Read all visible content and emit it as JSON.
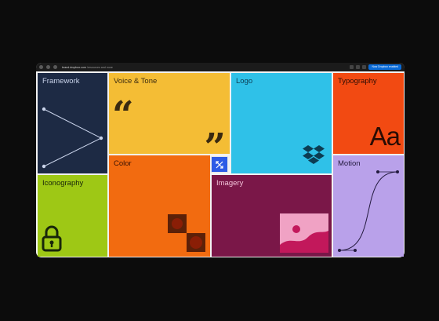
{
  "browser": {
    "url_host": "brand.dropbox.com",
    "url_rest": "/resources and more",
    "action_button": "Now Dropbox enabled"
  },
  "tiles": [
    {
      "id": "framework",
      "label": "Framework",
      "bg": "#1d2a44",
      "fg": "#c9d3ea"
    },
    {
      "id": "voice",
      "label": "Voice & Tone",
      "bg": "#f4bd35",
      "fg": "#3a2a10"
    },
    {
      "id": "logo",
      "label": "Logo",
      "bg": "#2fc1e8",
      "fg": "#0c3c52"
    },
    {
      "id": "typography",
      "label": "Typography",
      "bg": "#f24a12",
      "fg": "#2a0c04"
    },
    {
      "id": "iconography",
      "label": "Iconography",
      "bg": "#9ec815",
      "fg": "#18260a"
    },
    {
      "id": "color",
      "label": "Color",
      "bg": "#f26b10",
      "fg": "#3a1204"
    },
    {
      "id": "imagery",
      "label": "Imagery",
      "bg": "#7a1748",
      "fg": "#f2c2d8"
    },
    {
      "id": "motion",
      "label": "Motion",
      "bg": "#b9a1ea",
      "fg": "#231a3e"
    }
  ],
  "typography_sample": "Aa",
  "voice_quotes": {
    "open": "“",
    "close": "”"
  }
}
